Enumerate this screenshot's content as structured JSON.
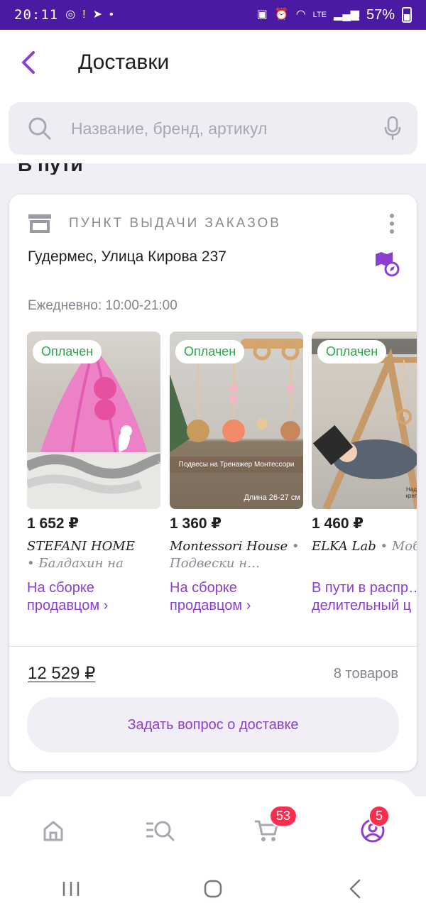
{
  "status_bar": {
    "time": "20:11",
    "battery": "57%",
    "network": "LTE"
  },
  "header": {
    "title": "Доставки"
  },
  "search": {
    "placeholder": "Название, бренд, артикул"
  },
  "section": {
    "title": "В пути"
  },
  "order": {
    "pickup_label": "ПУНКТ ВЫДАЧИ ЗАКАЗОВ",
    "address": "Гудермес, Улица Кирова 237",
    "hours": "Ежедневно: 10:00-21:00",
    "products": [
      {
        "badge": "Оплачен",
        "price": "1 652 ₽",
        "brand": "STEFANI HOME",
        "desc": "• Балдахин на кро…",
        "status": "На сборке продавцом ›",
        "image_caption": ""
      },
      {
        "badge": "Оплачен",
        "price": "1 360 ₽",
        "brand": "Montessori House",
        "desc": "• Подвески н…",
        "status": "На сборке продавцом ›",
        "image_caption": "Подвесы на Тренажер Монтессори",
        "image_caption2": "Длина 26-27 см"
      },
      {
        "badge": "Оплачен",
        "price": "1 460 ₽",
        "brand": "ELKA Lab",
        "desc": "• Моби… в кроватку для",
        "status": "В пути в распр… делительный ц",
        "image_caption": "Надежное крепление"
      }
    ],
    "total": "12 529 ₽",
    "count": "8 товаров",
    "ask_button": "Задать вопрос о доставке"
  },
  "tabbar": {
    "cart_badge": "53",
    "profile_badge": "5"
  },
  "colors": {
    "accent": "#8a3fd1",
    "status_bar": "#4a1aa3",
    "paid": "#2aa84a",
    "badge": "#ff2c4e"
  }
}
